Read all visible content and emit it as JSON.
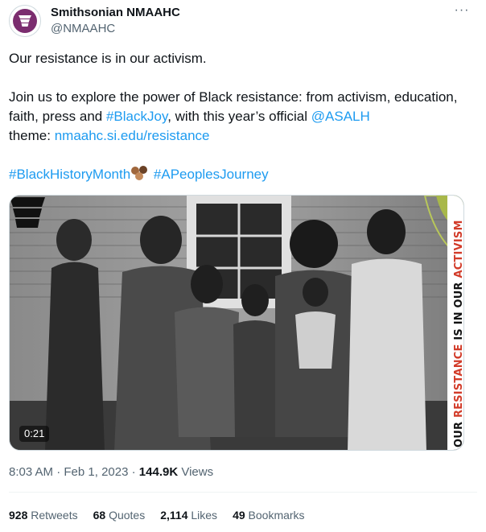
{
  "author": {
    "display_name": "Smithsonian NMAAHC",
    "handle": "@NMAAHC",
    "avatar_icon": "nmaahc-corona-logo-icon",
    "avatar_color": "#7b2d6f"
  },
  "more_label": "···",
  "tweet": {
    "line1": "Our resistance is in our activism.",
    "para2_text1": "Join us to explore the power of Black resistance: from activism, education, faith, press and ",
    "hashtag_blackjoy": "#BlackJoy",
    "para2_text2": ", with this year’s official ",
    "mention_asalh": "@ASALH",
    "para2_text3": " theme: ",
    "link_url": "nmaahc.si.edu/resistance",
    "hashtag_bhm": "#BlackHistoryMonth",
    "emoji": "raised-fists-emoji",
    "hashtag_journey": "#APeoplesJourney"
  },
  "media": {
    "duration": "0:21",
    "banner_black_1": "OUR ",
    "banner_red": "RESISTANCE",
    "banner_black_2": " IS IN OUR ",
    "banner_red_2": "ACTIVISM",
    "banner_red_color": "#d23c2a"
  },
  "meta": {
    "time": "8:03 AM",
    "separator": " · ",
    "date": "Feb 1, 2023",
    "views_count": "144.9K",
    "views_label": " Views"
  },
  "stats": [
    {
      "count": "928",
      "label": " Retweets"
    },
    {
      "count": "68",
      "label": " Quotes"
    },
    {
      "count": "2,114",
      "label": " Likes"
    },
    {
      "count": "49",
      "label": " Bookmarks"
    }
  ],
  "colors": {
    "link": "#1d9bf0",
    "text": "#0f1419",
    "secondary": "#536471"
  }
}
